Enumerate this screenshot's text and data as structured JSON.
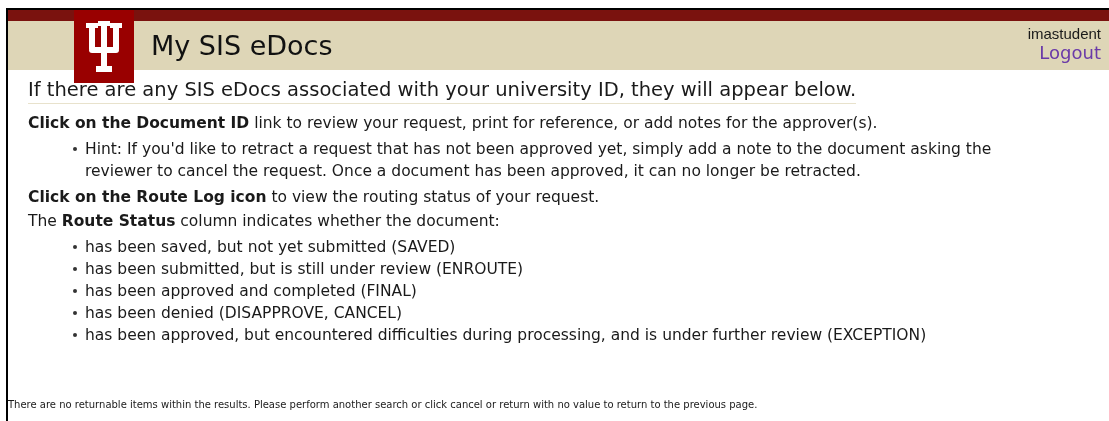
{
  "header": {
    "title": "My SIS eDocs",
    "username": "imastudent",
    "logout": "Logout"
  },
  "heading": "If there are any SIS eDocs associated with your university ID, they will appear below.",
  "sections": [
    {
      "text": "**Click on the Document ID** link to review your request, print for reference, or add notes for the approver(s).",
      "bullets": [
        "Hint: If you'd like to retract a request that has not been approved yet, simply add a note to the document asking the reviewer to cancel the request. Once a document has been approved, it can no longer be retracted."
      ]
    },
    {
      "text": "**Click on the Route Log icon** to view the routing status of your request."
    },
    {
      "text": "The **Route Status** column indicates whether the document:",
      "bullets": [
        "has been saved, but not yet submitted (SAVED)",
        "has been submitted, but is still under review (ENROUTE)",
        "has been approved and completed (FINAL)",
        "has been denied (DISAPPROVE, CANCEL)",
        "has been approved, but encountered difficulties during processing, and is under further review (EXCEPTION)"
      ]
    }
  ],
  "footer": "There are no returnable items within the results. Please perform another search or click cancel or return with no value to return to the previous page."
}
